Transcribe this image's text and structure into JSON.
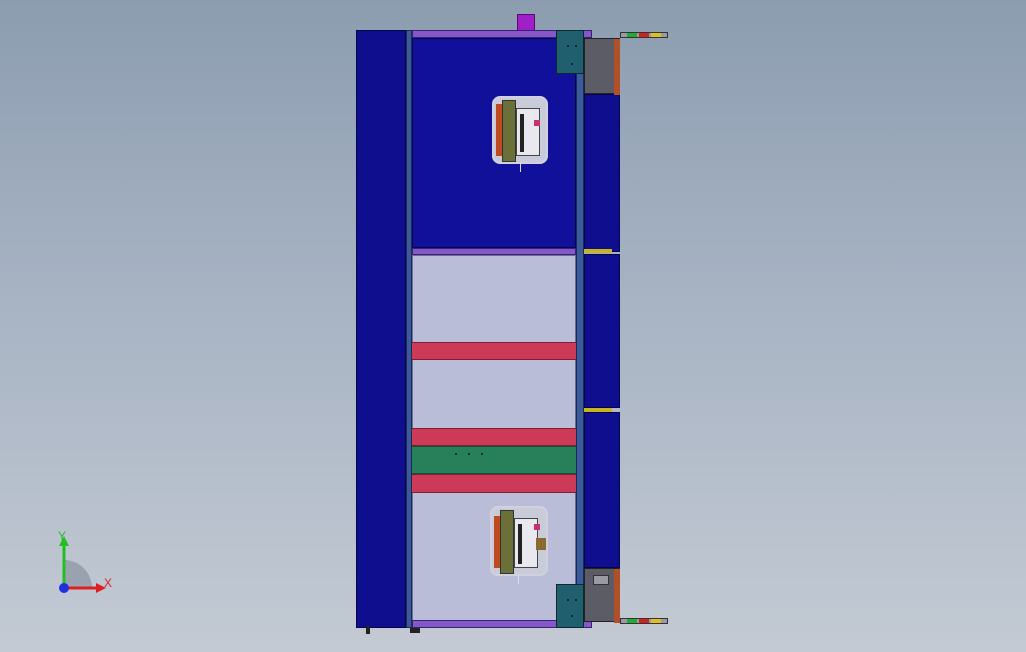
{
  "viewport": {
    "background_top": "#8c9db0",
    "background_bottom": "#c3cad4"
  },
  "model": {
    "main_color": "#0e0e8e",
    "frame_color": "#3a5a9a",
    "panel_color": "#b9bdd8",
    "accent_purple": "#8458c8",
    "stripe_red": "#cc3a58",
    "stripe_green": "#27805a",
    "teal_bracket": "#1f5f6e",
    "status_lights": [
      "#22aa33",
      "#cc2222",
      "#e0c020"
    ]
  },
  "triad": {
    "x_label": "X",
    "y_label": "Y",
    "x_color": "#e02020",
    "y_color": "#20c020",
    "z_color": "#2030e0"
  }
}
